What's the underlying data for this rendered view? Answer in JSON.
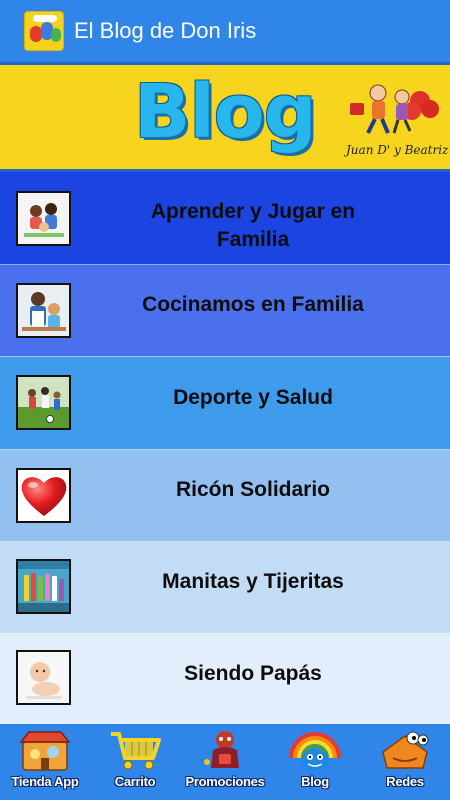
{
  "app_bar": {
    "title": "El Blog de Don Iris",
    "icon": "app-logo-icon"
  },
  "banner": {
    "title": "Blog",
    "signature": "Juan D' y Beatriz",
    "colors": {
      "background": "#f7d51e",
      "title": "#27b7ec"
    }
  },
  "menu": {
    "items": [
      {
        "label_line1": "Aprender y Jugar en",
        "label_line2": "Familia",
        "icon": "family-playing-photo",
        "color": "#1b44e0"
      },
      {
        "label_line1": "Cocinamos en Familia",
        "label_line2": "",
        "icon": "family-cooking-photo",
        "color": "#4a70ee"
      },
      {
        "label_line1": "Deporte y Salud",
        "label_line2": "",
        "icon": "family-sports-photo",
        "color": "#3f9cec"
      },
      {
        "label_line1": "Ricón Solidario",
        "label_line2": "",
        "icon": "heart-icon",
        "color": "#94bff1"
      },
      {
        "label_line1": "Manitas y Tijeritas",
        "label_line2": "",
        "icon": "crafts-photo",
        "color": "#c2dcf6"
      },
      {
        "label_line1": "Siendo Papás",
        "label_line2": "",
        "icon": "baby-photo",
        "color": "#e2eefb"
      }
    ]
  },
  "bottom_nav": {
    "items": [
      {
        "label": "Tienda App",
        "icon": "store-icon"
      },
      {
        "label": "Carrito",
        "icon": "cart-icon"
      },
      {
        "label": "Promociones",
        "icon": "promotions-icon"
      },
      {
        "label": "Blog",
        "icon": "blog-rainbow-icon"
      },
      {
        "label": "Redes",
        "icon": "social-networks-icon"
      }
    ]
  }
}
